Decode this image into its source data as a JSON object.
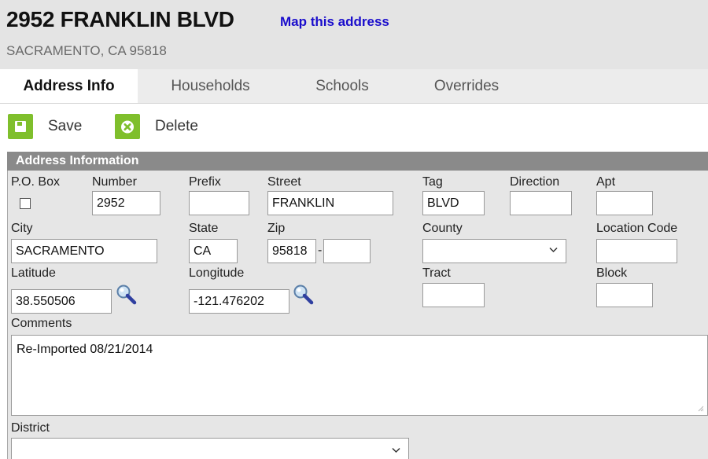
{
  "header": {
    "title": "2952 FRANKLIN BLVD",
    "map_link": "Map this address",
    "subtitle": "SACRAMENTO, CA 95818"
  },
  "tabs": [
    {
      "label": "Address Info",
      "active": true
    },
    {
      "label": "Households",
      "active": false
    },
    {
      "label": "Schools",
      "active": false
    },
    {
      "label": "Overrides",
      "active": false
    }
  ],
  "toolbar": {
    "save_label": "Save",
    "delete_label": "Delete",
    "save_icon": "floppy-icon",
    "delete_icon": "x-circle-icon",
    "icon_color": "#7fbf2c"
  },
  "panel": {
    "title": "Address Information"
  },
  "fields": {
    "po_box": {
      "label": "P.O. Box",
      "checked": false
    },
    "number": {
      "label": "Number",
      "value": "2952"
    },
    "prefix": {
      "label": "Prefix",
      "value": ""
    },
    "street": {
      "label": "Street",
      "value": "FRANKLIN"
    },
    "tag": {
      "label": "Tag",
      "value": "BLVD"
    },
    "direction": {
      "label": "Direction",
      "value": ""
    },
    "apt": {
      "label": "Apt",
      "value": ""
    },
    "city": {
      "label": "City",
      "value": "SACRAMENTO"
    },
    "state": {
      "label": "State",
      "value": "CA"
    },
    "zip": {
      "label": "Zip",
      "value": "95818",
      "separator": "-",
      "ext_value": ""
    },
    "county": {
      "label": "County",
      "value": ""
    },
    "location_code": {
      "label": "Location Code",
      "value": ""
    },
    "latitude": {
      "label": "Latitude",
      "value": "38.550506"
    },
    "longitude": {
      "label": "Longitude",
      "value": "-121.476202"
    },
    "tract": {
      "label": "Tract",
      "value": ""
    },
    "block": {
      "label": "Block",
      "value": ""
    },
    "comments": {
      "label": "Comments",
      "value": "Re-Imported 08/21/2014"
    },
    "district": {
      "label": "District",
      "value": ""
    }
  }
}
